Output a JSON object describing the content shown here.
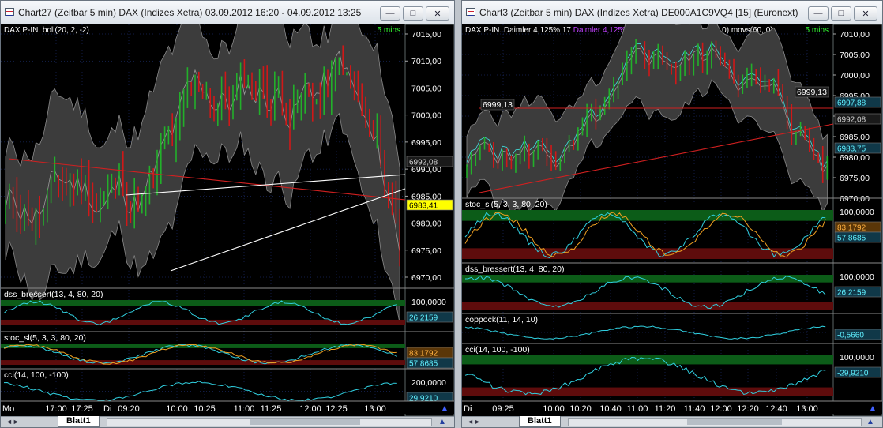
{
  "colors": {
    "background": "#000000",
    "grid": "#243b8c",
    "up_bar": "#22b02a",
    "down_bar": "#d01818",
    "band": "#3c3c3c",
    "band_edge": "#8a8a8a",
    "last_label_bg": "#ffff00",
    "osc_top_zone": "#0c5c18",
    "osc_bottom_zone": "#5e0c0c",
    "osc_line1": "#30d0e0",
    "osc_line2": "#f0a020"
  },
  "windows": [
    {
      "title": "Chart27 (Zeitbar 5 min)  DAX (Indizes Xetra) 03.09.2012 16:20 - 04.09.2012 13:25",
      "legend": "DAX P-IN.  boll(20, 2, -2)",
      "legend_segments": [],
      "interval": "5 mins",
      "minimize_icon": "minimize-icon",
      "maximize_icon": "maximize-icon",
      "close_icon": "close-icon",
      "price_axis": [
        "7015,00",
        "7010,00",
        "7005,00",
        "7000,00",
        "6995,00",
        "6990,00",
        "6985,00",
        "6980,00",
        "6975,00",
        "6970,00"
      ],
      "price_labels": [
        {
          "text": "6992,08",
          "kind": "grey"
        },
        {
          "text": "6983,41",
          "kind": "yellow"
        }
      ],
      "panes": [
        {
          "label": "dss_bressert(13, 4, 80, 20)",
          "axis": [
            "100,0000"
          ],
          "value_labels": [
            {
              "text": "26,2159",
              "kind": "cyan"
            }
          ]
        },
        {
          "label": "stoc_sl(5, 3, 3, 80, 20)",
          "axis": [],
          "value_labels": [
            {
              "text": "83,1792",
              "kind": "orange"
            },
            {
              "text": "57,8685",
              "kind": "cyan"
            }
          ]
        },
        {
          "label": "cci(14, 100, -100)",
          "axis": [
            "200,0000"
          ],
          "value_labels": [
            {
              "text": "29,9210",
              "kind": "cyan"
            }
          ]
        }
      ],
      "time_axis": {
        "day_start": "Mo",
        "day_mid": "Di",
        "labels": [
          "17:00",
          "17:25",
          "09:20",
          "10:00",
          "10:25",
          "11:00",
          "11:25",
          "12:00",
          "12:25",
          "13:00"
        ]
      },
      "sheet_tab": "Blatt1"
    },
    {
      "title": "Chart3 (Zeitbar 5 min)  DAX (Indizes Xetra) DE000A1C9VQ4 [15] (Euronext)",
      "legend": "DAX P-IN.  Daimler  4,125% 17  Daimler  4,125% 17  boll(20, 2, -2)  move(9, 0)  movs(60, 0)",
      "legend_segments": [
        {
          "text": "DAX P-IN.",
          "color": "#ffffff"
        },
        {
          "text": "Daimler  4,125% 17",
          "color": "#ffffff"
        },
        {
          "text": "Daimler  4,125% 17",
          "color": "#c040ff"
        },
        {
          "text": "boll(20, 2, -2)",
          "color": "#ffffff"
        },
        {
          "text": "move(9, 0)",
          "color": "#ffffff"
        },
        {
          "text": "movs(60, 0)",
          "color": "#ffffff"
        }
      ],
      "interval": "5 mins",
      "minimize_icon": "minimize-icon",
      "maximize_icon": "maximize-icon",
      "close_icon": "close-icon",
      "price_axis": [
        "7010,00",
        "7005,00",
        "7000,00",
        "6995,00",
        "6990,00",
        "6985,00",
        "6980,00",
        "6975,00",
        "6970,00"
      ],
      "price_labels": [
        {
          "text": "6997,88",
          "kind": "cyan"
        },
        {
          "text": "6992,08",
          "kind": "grey"
        },
        {
          "text": "6983,75",
          "kind": "cyan"
        }
      ],
      "chart_texts": [
        "6999,13",
        "6999,13"
      ],
      "panes": [
        {
          "label": "stoc_sl(5, 3, 3, 80, 20)",
          "axis": [
            "100,0000"
          ],
          "value_labels": [
            {
              "text": "83,1792",
              "kind": "orange"
            },
            {
              "text": "57,8685",
              "kind": "cyan"
            }
          ]
        },
        {
          "label": "dss_bressert(13, 4, 80, 20)",
          "axis": [
            "100,0000"
          ],
          "value_labels": [
            {
              "text": "26,2159",
              "kind": "cyan"
            }
          ]
        },
        {
          "label": "coppock(11, 14, 10)",
          "axis": [],
          "value_labels": [
            {
              "text": "-0,5660",
              "kind": "cyan"
            }
          ]
        },
        {
          "label": "cci(14, 100, -100)",
          "axis": [
            "100,0000"
          ],
          "value_labels": [
            {
              "text": "-29,9210",
              "kind": "cyan"
            }
          ]
        }
      ],
      "time_axis": {
        "day_start": "Di",
        "day_mid": "",
        "labels": [
          "09:25",
          "10:00",
          "10:20",
          "10:40",
          "11:00",
          "11:20",
          "11:40",
          "12:00",
          "12:20",
          "12:40",
          "13:00"
        ]
      },
      "sheet_tab": "Blatt1"
    }
  ]
}
